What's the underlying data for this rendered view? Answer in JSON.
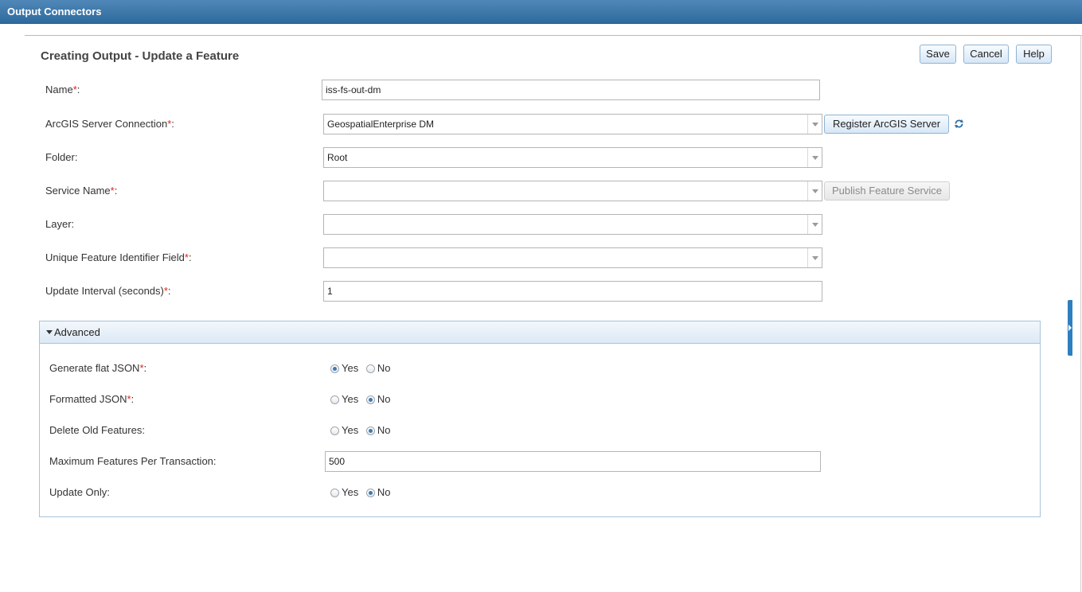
{
  "window": {
    "title": "Output Connectors"
  },
  "page": {
    "title": "Creating Output - Update a Feature"
  },
  "toolbar": {
    "save": "Save",
    "cancel": "Cancel",
    "help": "Help"
  },
  "form": {
    "required_marker": "*",
    "name": {
      "label": "Name",
      "value": "iss-fs-out-dm"
    },
    "server_connection": {
      "label": "ArcGIS Server Connection",
      "value": "GeospatialEnterprise DM",
      "register_button": "Register ArcGIS Server"
    },
    "folder": {
      "label": "Folder:",
      "value": "Root"
    },
    "service_name": {
      "label": "Service Name",
      "value": "",
      "publish_button": "Publish Feature Service"
    },
    "layer": {
      "label": "Layer:",
      "value": ""
    },
    "unique_id_field": {
      "label": "Unique Feature Identifier Field",
      "value": ""
    },
    "update_interval": {
      "label": "Update Interval (seconds)",
      "value": "1"
    }
  },
  "advanced": {
    "header": "Advanced",
    "yes": "Yes",
    "no": "No",
    "generate_flat_json": {
      "label": "Generate flat JSON",
      "selected": "Yes"
    },
    "formatted_json": {
      "label": "Formatted JSON",
      "selected": "No"
    },
    "delete_old_features": {
      "label": "Delete Old Features:",
      "selected": "No"
    },
    "max_features": {
      "label": "Maximum Features Per Transaction:",
      "value": "500"
    },
    "update_only": {
      "label": "Update Only:",
      "selected": "No"
    }
  },
  "colors": {
    "titlebar": "#2f6a9d",
    "required": "#e0221b",
    "accent": "#3e7ab3"
  }
}
